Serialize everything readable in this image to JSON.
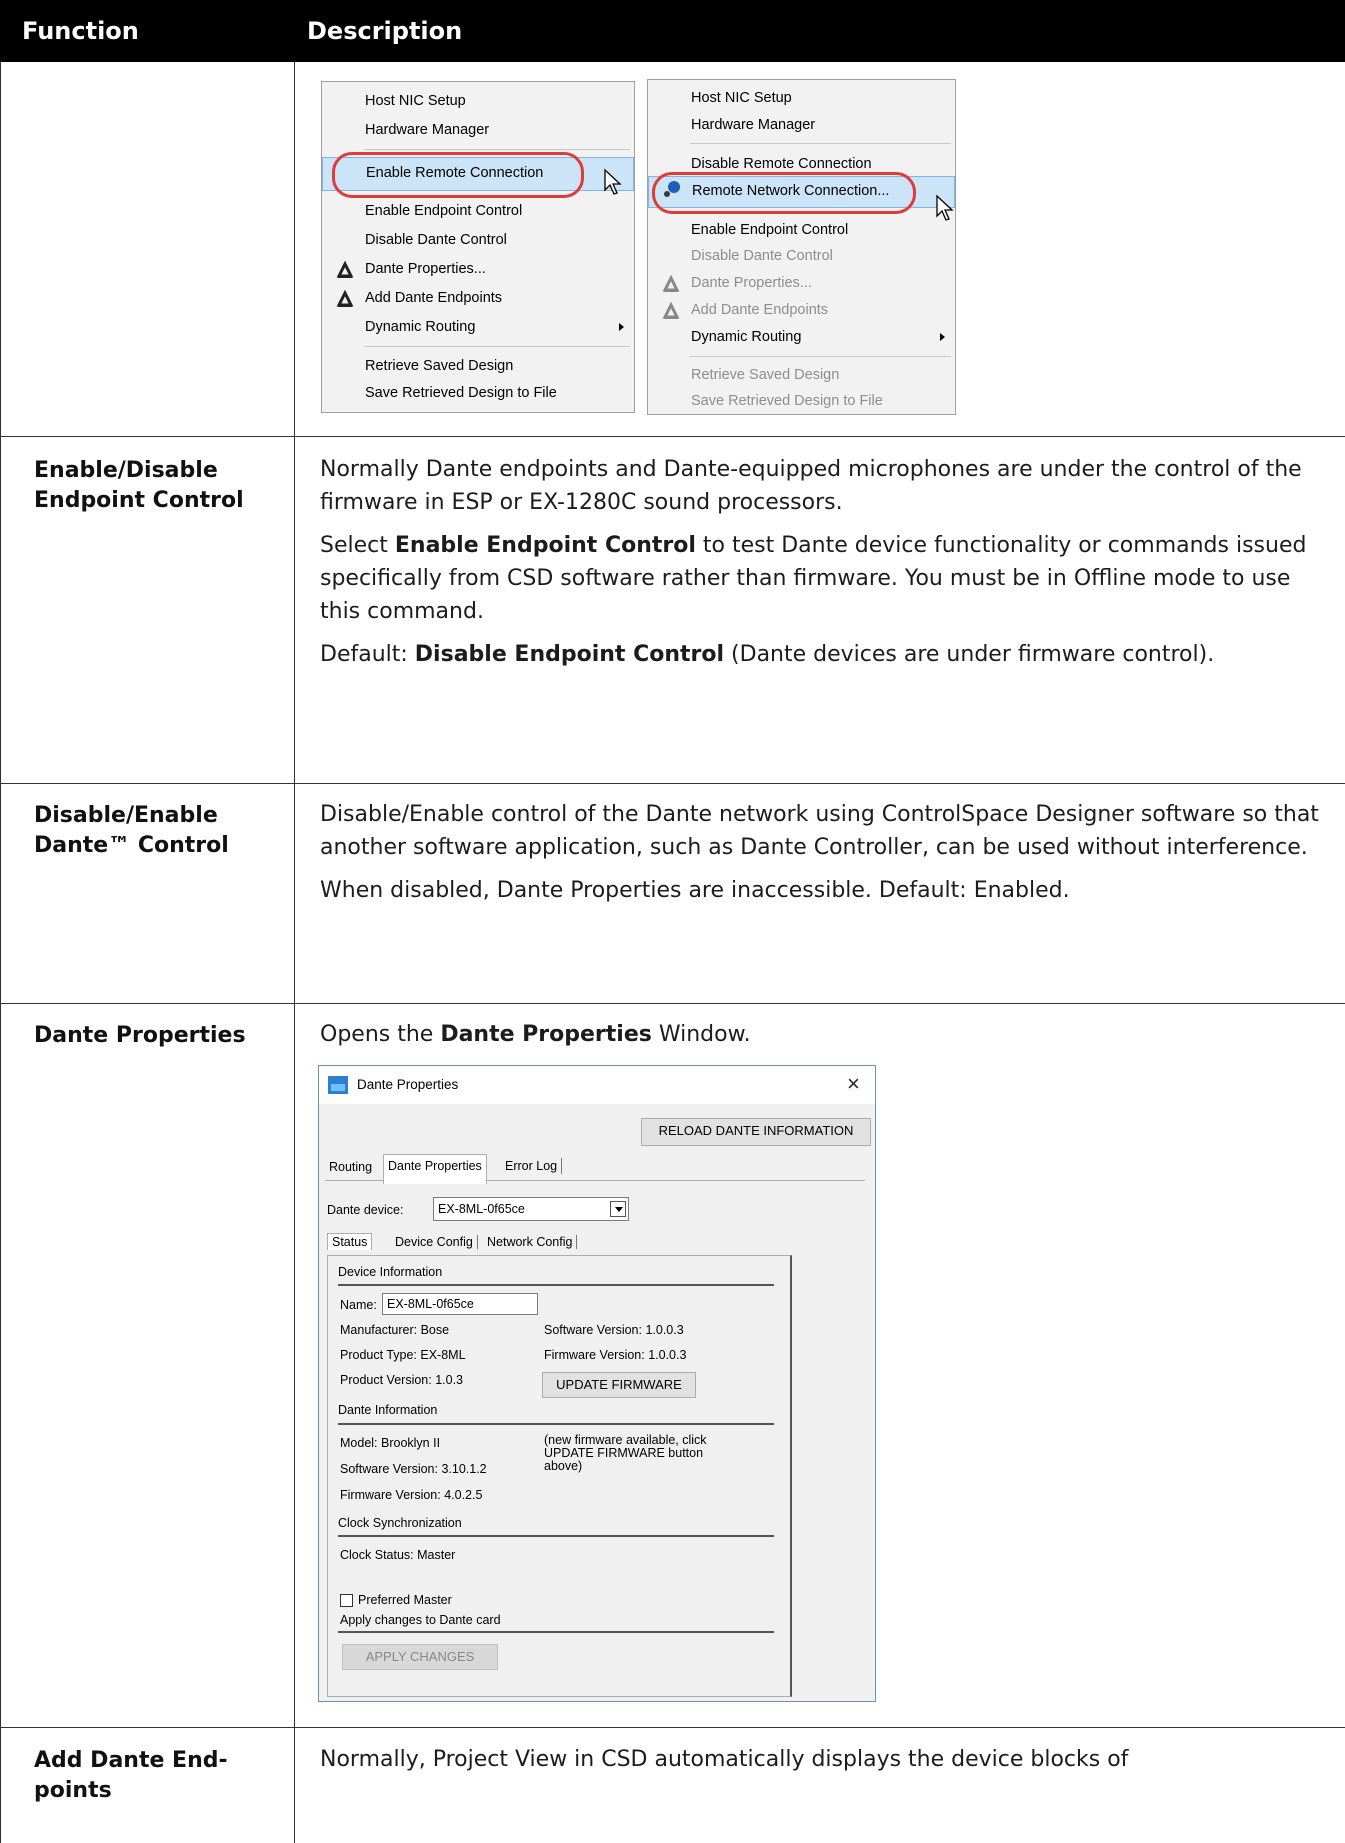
{
  "header": {
    "col1": "Function",
    "col2": "Description"
  },
  "menu1": {
    "items": [
      {
        "label": "Host NIC Setup"
      },
      {
        "label": "Hardware Manager"
      },
      {
        "label": "Enable Remote Connection"
      },
      {
        "label": "Enable Endpoint Control"
      },
      {
        "label": "Disable Dante Control"
      },
      {
        "label": "Dante Properties..."
      },
      {
        "label": "Add Dante Endpoints"
      },
      {
        "label": "Dynamic Routing"
      },
      {
        "label": "Retrieve Saved Design"
      },
      {
        "label": "Save Retrieved Design to File"
      }
    ]
  },
  "menu2": {
    "items": [
      {
        "label": "Host NIC Setup"
      },
      {
        "label": "Hardware Manager"
      },
      {
        "label": "Disable Remote Connection"
      },
      {
        "label": "Remote Network Connection..."
      },
      {
        "label": "Enable Endpoint Control"
      },
      {
        "label": "Disable Dante Control"
      },
      {
        "label": "Dante Properties..."
      },
      {
        "label": "Add Dante Endpoints"
      },
      {
        "label": "Dynamic Routing"
      },
      {
        "label": "Retrieve Saved Design"
      },
      {
        "label": "Save Retrieved Design to File"
      }
    ]
  },
  "rows": {
    "endpoint": {
      "function": "Enable/Disable Endpoint Control",
      "p1": "Normally Dante endpoints and Dante-equipped microphones are under the control of the firmware in ESP or EX-1280C sound processors.",
      "p2_pre": "Select ",
      "p2_bold": "Enable Endpoint Control",
      "p2_post": " to test Dante device functionality or com­mands issued specifically from CSD software rather than firmware. You must be in Offline mode to use this command.",
      "p3_pre": "Default: ",
      "p3_bold": "Disable Endpoint Control",
      "p3_post": " (Dante devices are under firmware con­trol)."
    },
    "dante_control": {
      "function": "Disable/Enable Dante™ Control",
      "p1": "Disable/Enable control of the Dante network using ControlSpace Designer software so that another software application, such as Dante Controller, can be used without interference.",
      "p2": "When disabled, Dante Properties are inaccessible. Default: Enabled."
    },
    "properties": {
      "function": "Dante Properties",
      "p1_pre": "Opens the ",
      "p1_bold": "Dante Properties",
      "p1_post": " Window."
    },
    "add_endpoints": {
      "function": "Add Dante End­points",
      "p1": "Normally, Project View in CSD automatically displays the device blocks of"
    }
  },
  "dialog": {
    "title": "Dante Properties",
    "close": "×",
    "reload_button": "RELOAD DANTE INFORMATION",
    "tabs": [
      "Routing",
      "Dante Properties",
      "Error Log"
    ],
    "device_label": "Dante device:",
    "device_value": "EX-8ML-0f65ce",
    "subtabs": [
      "Status",
      "Device Config",
      "Network Config"
    ],
    "device_info": {
      "heading": "Device Information",
      "name_label": "Name:",
      "name_value": "EX-8ML-0f65ce",
      "manufacturer": "Manufacturer:  Bose",
      "product_type": "Product Type:  EX-8ML",
      "product_version": "Product Version:  1.0.3",
      "software_version": "Software Version:  1.0.0.3",
      "firmware_version": "Firmware Version:  1.0.0.3",
      "update_button": "UPDATE FIRMWARE"
    },
    "dante_info": {
      "heading": "Dante Information",
      "model": "Model:  Brooklyn II",
      "software_version": "Software Version:  3.10.1.2",
      "firmware_version": "Firmware Version:  4.0.2.5",
      "note_line1": "(new firmware available, click",
      "note_line2": "UPDATE  FIRMWARE  button",
      "note_line3": "above)"
    },
    "clock": {
      "heading": "Clock Synchronization",
      "status": "Clock Status: Master",
      "preferred_master": "Preferred Master"
    },
    "apply": {
      "heading": "Apply changes to Dante card",
      "button": "APPLY CHANGES"
    }
  }
}
